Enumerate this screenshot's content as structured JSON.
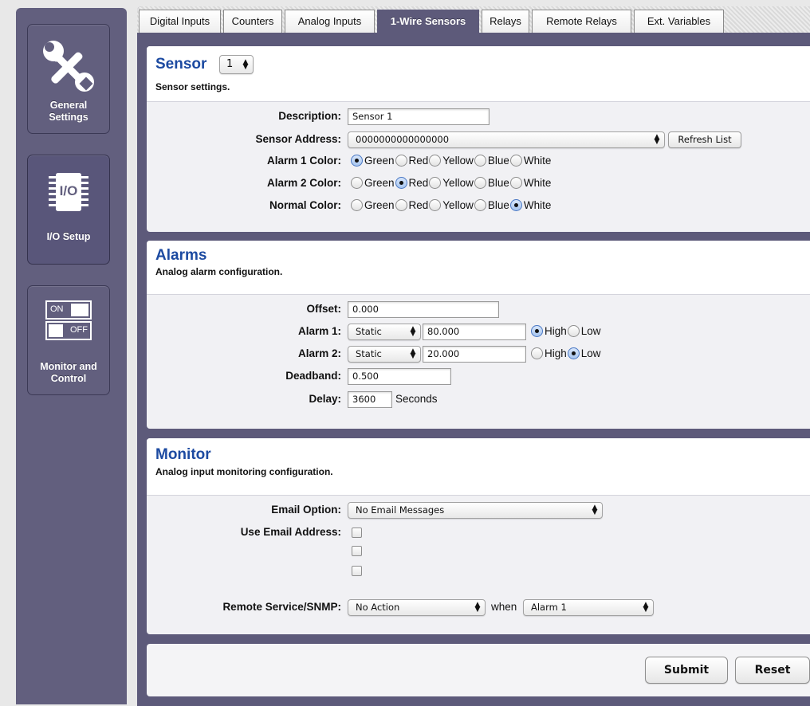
{
  "sidebar": {
    "items": [
      {
        "label_line1": "General",
        "label_line2": "Settings",
        "icon": "tools-icon"
      },
      {
        "label": "I/O Setup",
        "icon": "chip-icon",
        "icon_text": "I/O"
      },
      {
        "label_line1": "Monitor and",
        "label_line2": "Control",
        "icon": "switch-icon",
        "icon_on": "ON",
        "icon_off": "OFF"
      }
    ]
  },
  "tabs": [
    "Digital Inputs",
    "Counters",
    "Analog Inputs",
    "1-Wire Sensors",
    "Relays",
    "Remote Relays",
    "Ext. Variables"
  ],
  "active_tab": "1-Wire Sensors",
  "sensor": {
    "title": "Sensor",
    "selected": "1",
    "subtitle": "Sensor settings.",
    "description_label": "Description:",
    "description_value": "Sensor 1",
    "address_label": "Sensor Address:",
    "address_value": "0000000000000000",
    "refresh_label": "Refresh List",
    "alarm1_label": "Alarm 1 Color:",
    "alarm2_label": "Alarm 2 Color:",
    "normal_label": "Normal Color:",
    "colors": [
      "Green",
      "Red",
      "Yellow",
      "Blue",
      "White"
    ],
    "alarm1_selected": "Green",
    "alarm2_selected": "Red",
    "normal_selected": "White"
  },
  "alarms": {
    "title": "Alarms",
    "subtitle": "Analog alarm configuration.",
    "offset_label": "Offset:",
    "offset_value": "0.000",
    "alarm1_label": "Alarm 1:",
    "alarm1_mode": "Static",
    "alarm1_value": "80.000",
    "alarm1_level": "High",
    "alarm2_label": "Alarm 2:",
    "alarm2_mode": "Static",
    "alarm2_value": "20.000",
    "alarm2_level": "Low",
    "level_options": [
      "High",
      "Low"
    ],
    "deadband_label": "Deadband:",
    "deadband_value": "0.500",
    "delay_label": "Delay:",
    "delay_value": "3600",
    "delay_unit": "Seconds"
  },
  "monitor": {
    "title": "Monitor",
    "subtitle": "Analog input monitoring configuration.",
    "email_option_label": "Email Option:",
    "email_option_value": "No Email Messages",
    "use_email_label": "Use Email Address:",
    "remote_label": "Remote Service/SNMP:",
    "remote_action": "No Action",
    "when_label": "when",
    "when_value": "Alarm 1"
  },
  "actions": {
    "submit": "Submit",
    "reset": "Reset"
  }
}
